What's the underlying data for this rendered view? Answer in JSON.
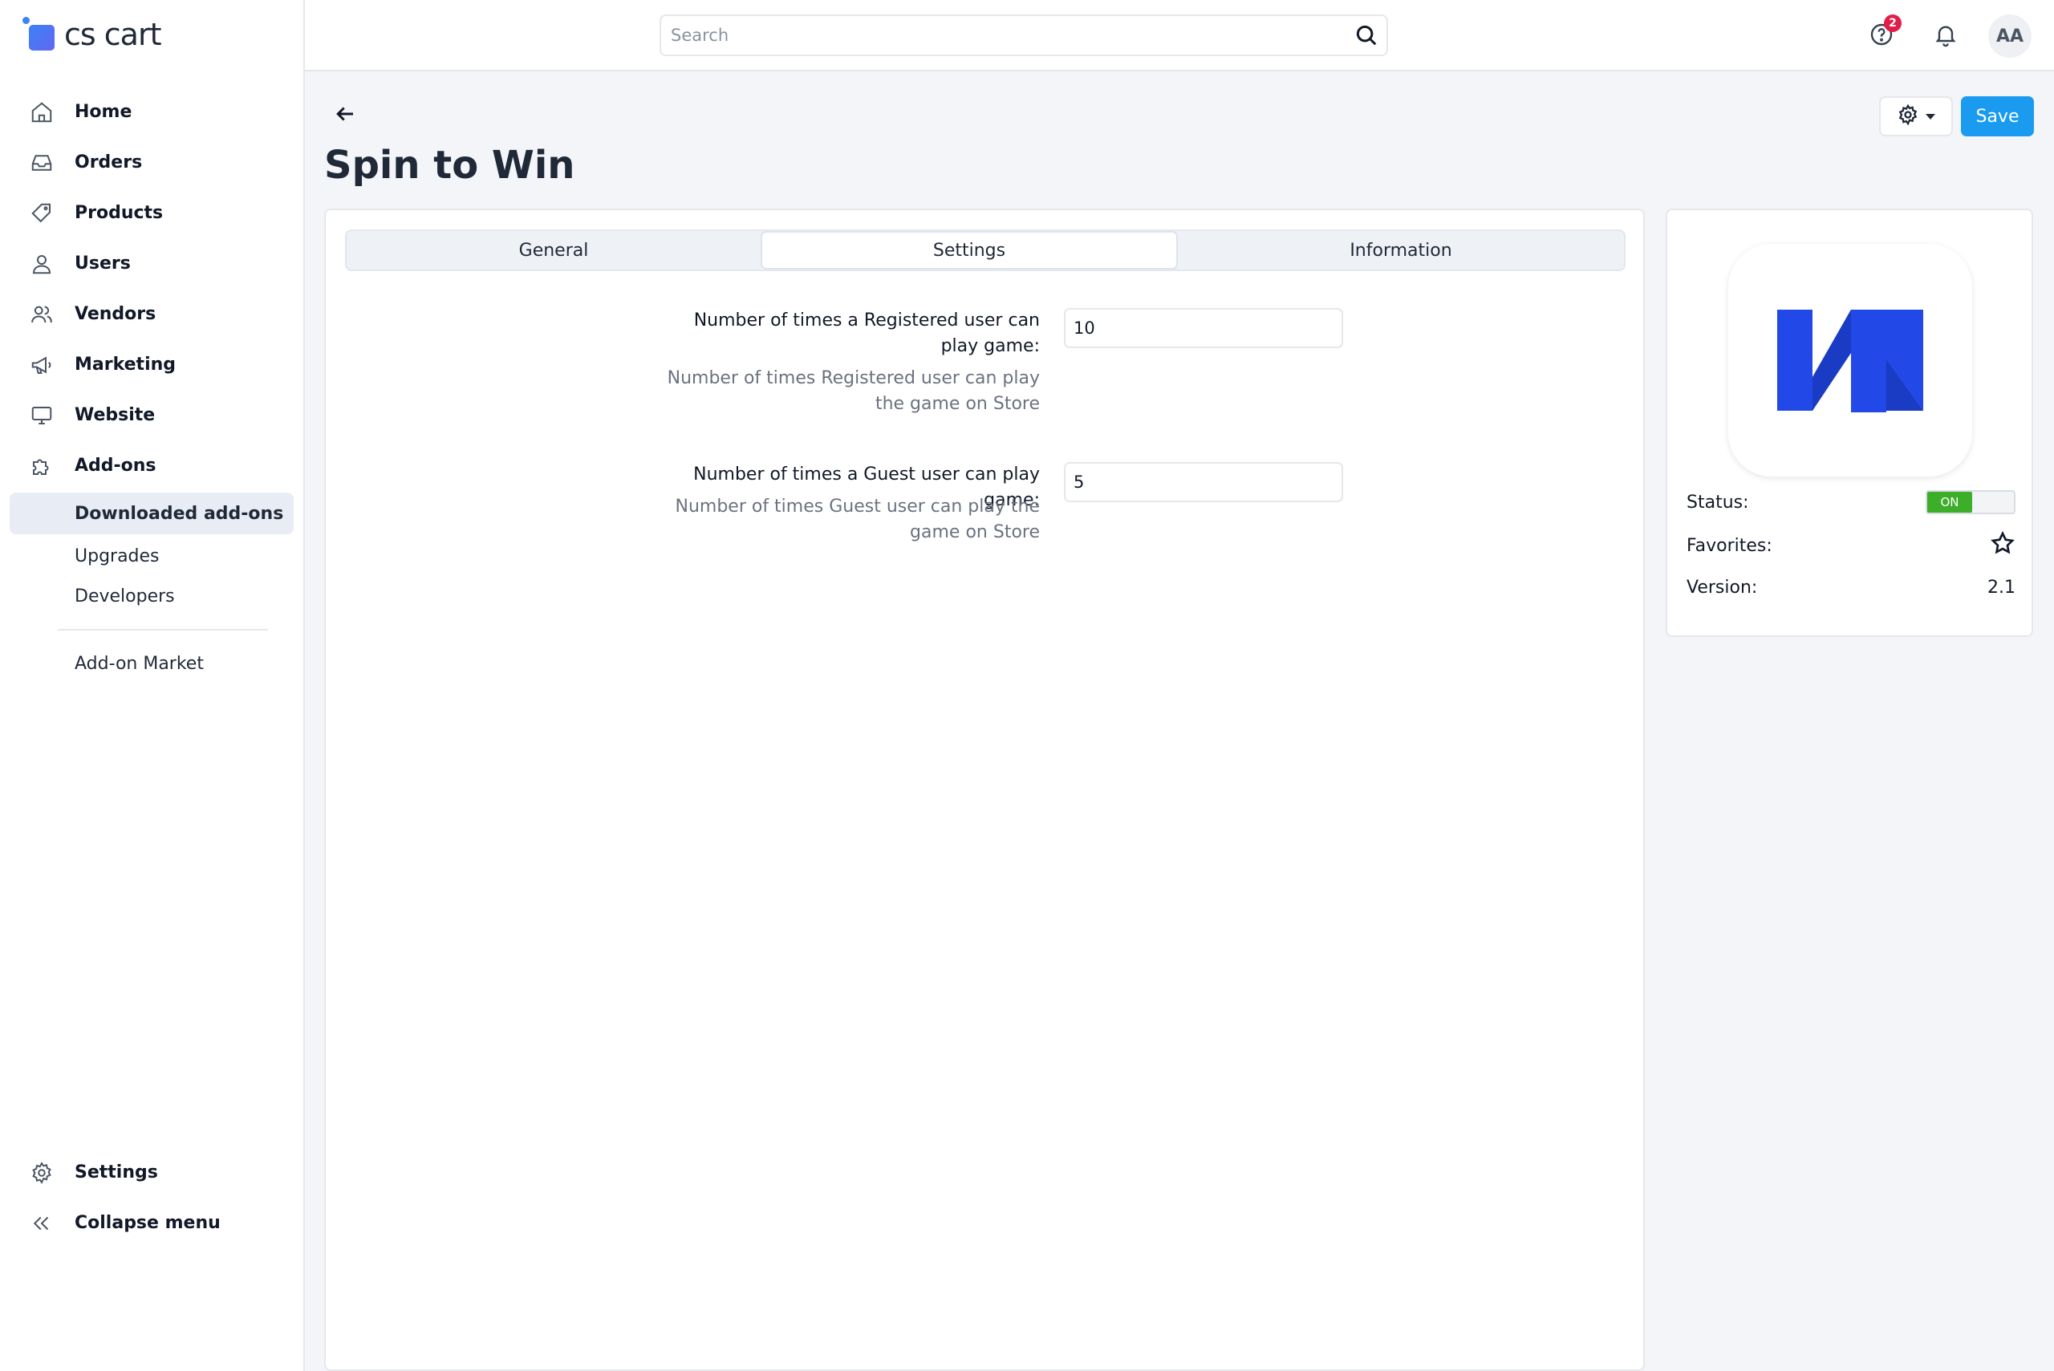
{
  "app": {
    "logo_text": "cs cart"
  },
  "sidebar": {
    "items": [
      {
        "label": "Home",
        "icon": "home-icon"
      },
      {
        "label": "Orders",
        "icon": "inbox-icon"
      },
      {
        "label": "Products",
        "icon": "tag-icon"
      },
      {
        "label": "Users",
        "icon": "user-icon"
      },
      {
        "label": "Vendors",
        "icon": "users-icon"
      },
      {
        "label": "Marketing",
        "icon": "megaphone-icon"
      },
      {
        "label": "Website",
        "icon": "monitor-icon"
      },
      {
        "label": "Add-ons",
        "icon": "puzzle-icon"
      }
    ],
    "sub_items": [
      {
        "label": "Downloaded add-ons",
        "active": true
      },
      {
        "label": "Upgrades"
      },
      {
        "label": "Developers"
      }
    ],
    "market_label": "Add-on Market",
    "settings_label": "Settings",
    "collapse_label": "Collapse menu"
  },
  "topbar": {
    "search_placeholder": "Search",
    "help_badge": "2",
    "avatar_initials": "AA"
  },
  "page": {
    "title": "Spin to Win",
    "save_label": "Save"
  },
  "tabs": [
    {
      "label": "General"
    },
    {
      "label": "Settings",
      "active": true
    },
    {
      "label": "Information"
    }
  ],
  "fields": [
    {
      "label": "Number of times a Registered user can play game:",
      "help": "Number of times Registered user can play the game on Store",
      "value": "10"
    },
    {
      "label": "Number of times a Guest user can play game:",
      "help": "Number of times Guest user can play the game on Store",
      "value": "5"
    }
  ],
  "addon_card": {
    "status_label": "Status:",
    "status_value": "ON",
    "favorites_label": "Favorites:",
    "version_label": "Version:",
    "version_value": "2.1"
  },
  "colors": {
    "accent": "#1a9bf0",
    "status_on": "#3cae2a",
    "badge": "#e11d48",
    "addon_logo": "#2348e8"
  }
}
